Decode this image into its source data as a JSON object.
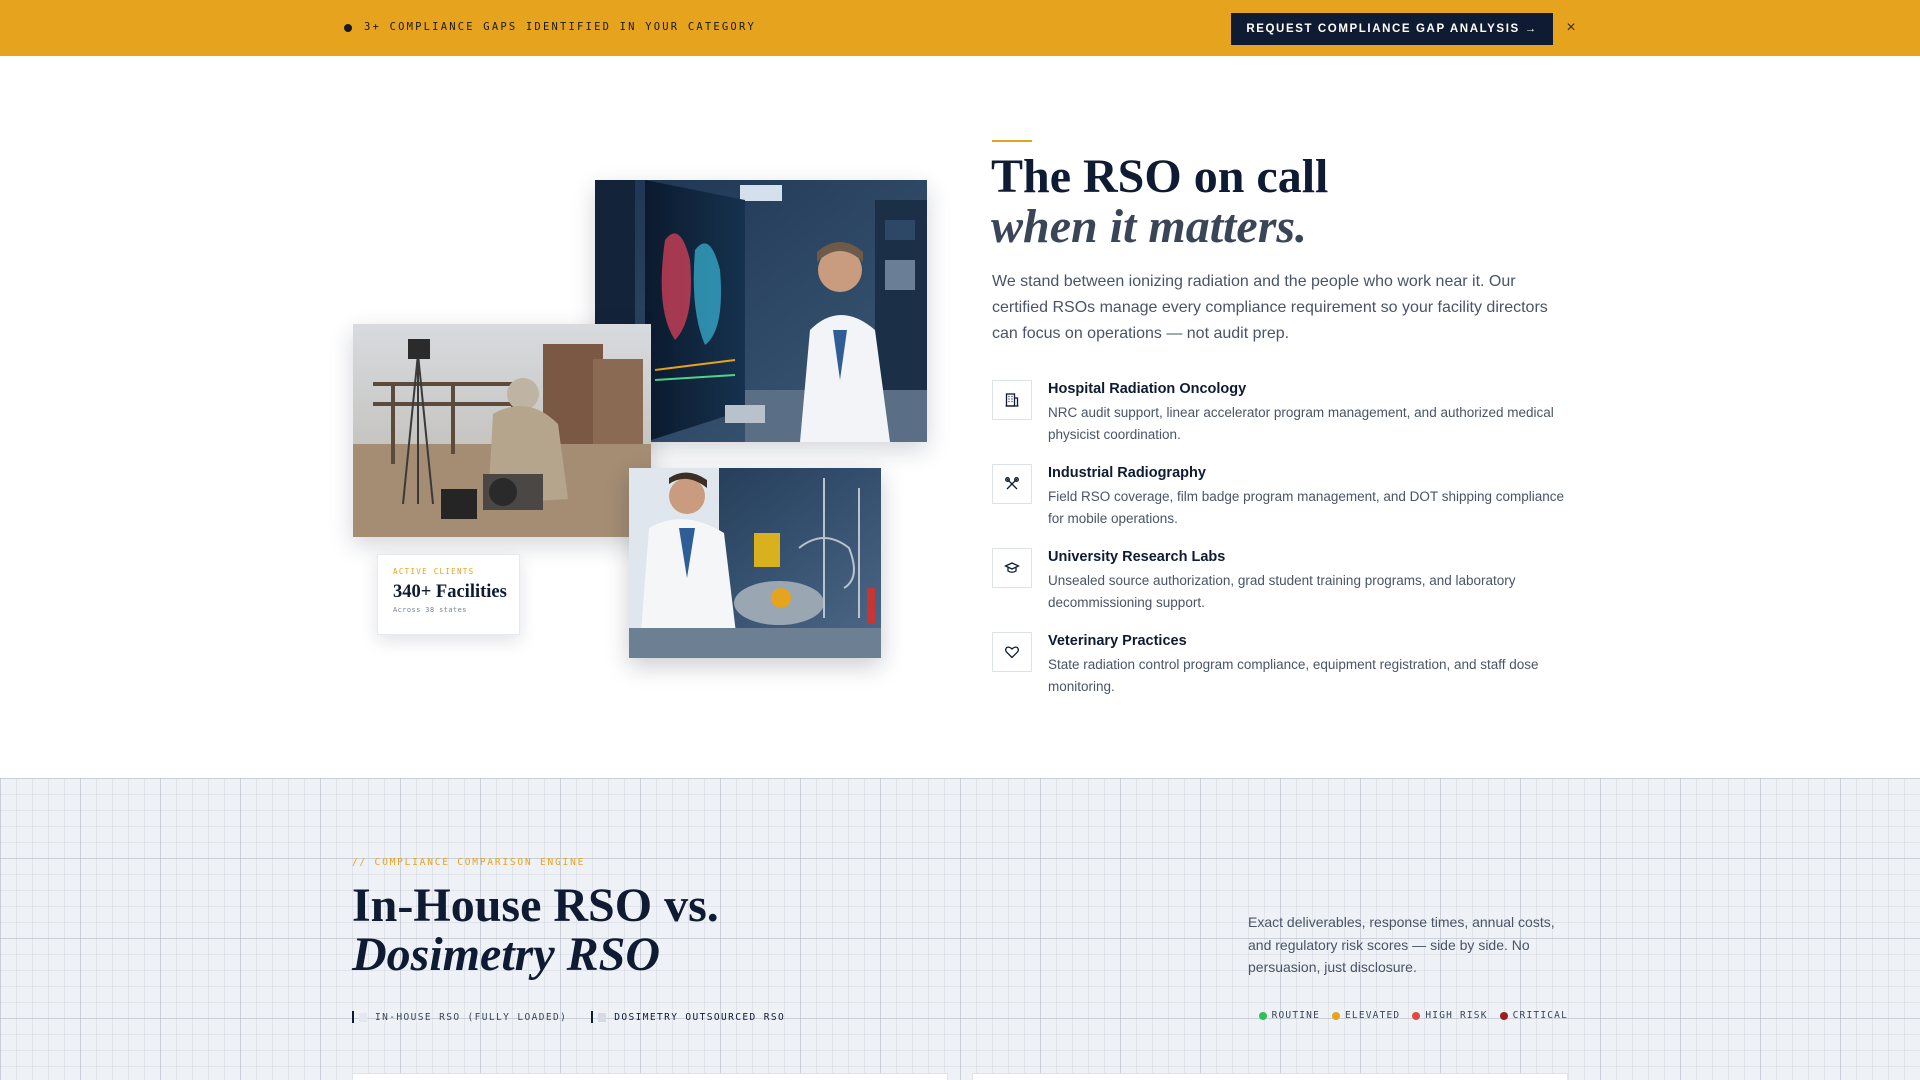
{
  "banner": {
    "text": "3+ COMPLIANCE GAPS IDENTIFIED IN YOUR CATEGORY",
    "cta_label": "REQUEST COMPLIANCE GAP ANALYSIS →",
    "close_glyph": "×",
    "color": "#e6a31d"
  },
  "stat_card": {
    "label": "ACTIVE CLIENTS",
    "value": "340+ Facilities",
    "sub": "Across 38 states"
  },
  "hero": {
    "title_line1": "The RSO on call",
    "title_line2": "when it matters.",
    "description": "We stand between ionizing radiation and the people who work near it. Our certified RSOs manage every compliance requirement so your facility directors can focus on operations — not audit prep."
  },
  "services": [
    {
      "icon": "building-icon",
      "title": "Hospital Radiation Oncology",
      "description": "NRC audit support, linear accelerator program management, and authorized medical physicist coordination."
    },
    {
      "icon": "tools-icon",
      "title": "Industrial Radiography",
      "description": "Field RSO coverage, film badge program management, and DOT shipping compliance for mobile operations."
    },
    {
      "icon": "graduation-cap-icon",
      "title": "University Research Labs",
      "description": "Unsealed source authorization, grad student training programs, and laboratory decommissioning support."
    },
    {
      "icon": "heart-icon",
      "title": "Veterinary Practices",
      "description": "State radiation control program compliance, equipment registration, and staff dose monitoring."
    }
  ],
  "comparison": {
    "eyebrow": "// COMPLIANCE COMPARISON ENGINE",
    "title_line1": "In-House RSO vs.",
    "title_line2": "Dosimetry RSO",
    "description": "Exact deliverables, response times, annual costs, and regulatory risk scores — side by side. No persuasion, just disclosure.",
    "legend": [
      {
        "label": "IN-HOUSE RSO (FULLY LOADED)",
        "swatch": "#e3e7ee"
      },
      {
        "label": "DOSIMETRY OUTSOURCED RSO",
        "swatch": "#d5dae3"
      }
    ],
    "risk_levels": [
      {
        "label": "ROUTINE",
        "color": "#2fbf5b"
      },
      {
        "label": "ELEVATED",
        "color": "#e6a31d"
      },
      {
        "label": "HIGH RISK",
        "color": "#e04848"
      },
      {
        "label": "CRITICAL",
        "color": "#9e1c1c"
      }
    ]
  }
}
